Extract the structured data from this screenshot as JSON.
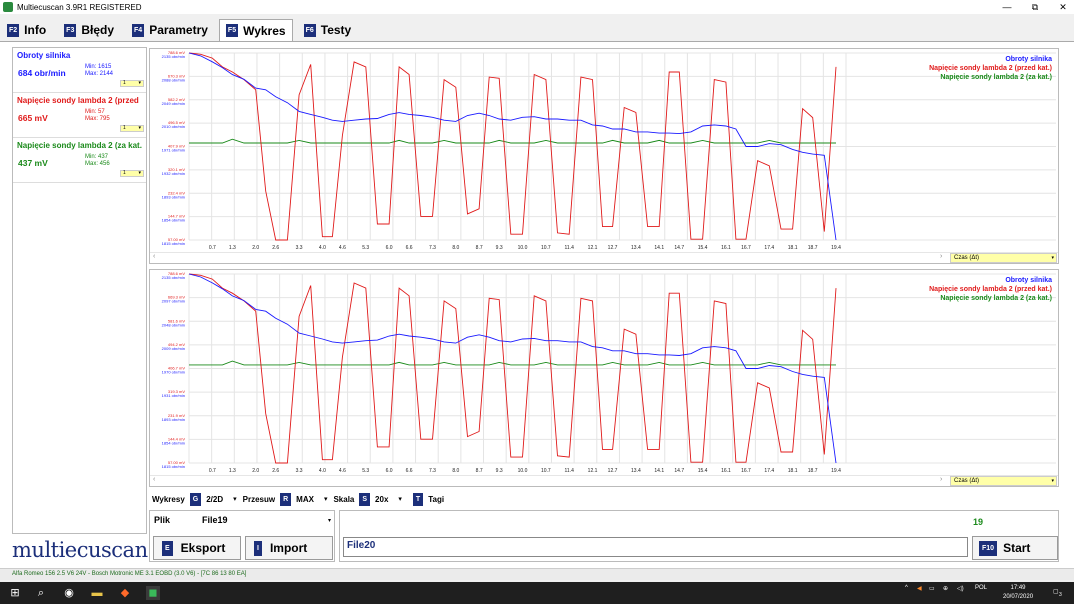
{
  "window": {
    "title": "Multiecuscan 3.9R1 REGISTERED",
    "minimize": "—",
    "maximize": "⧉",
    "close": "✕"
  },
  "tabs": [
    {
      "key": "F2",
      "label": "Info"
    },
    {
      "key": "F3",
      "label": "Błędy"
    },
    {
      "key": "F4",
      "label": "Parametry"
    },
    {
      "key": "F5",
      "label": "Wykres"
    },
    {
      "key": "F6",
      "label": "Testy"
    }
  ],
  "sensors": [
    {
      "name": "Obroty silnika",
      "value": "684 obr/min",
      "min": "Min: 1615",
      "max": "Max: 2144",
      "color": "#1a1aff"
    },
    {
      "name": "Napięcie sondy lambda 2 (przed",
      "value": "665 mV",
      "min": "Min: 57",
      "max": "Max: 795",
      "color": "#e01a1a"
    },
    {
      "name": "Napięcie sondy lambda 2 (za kat.",
      "value": "437 mV",
      "min": "Min: 437",
      "max": "Max: 456",
      "color": "#1a8a1a"
    }
  ],
  "legend": [
    "Obroty silnika",
    "Napięcie sondy lambda 2 (przed kat.)",
    "Napięcie sondy lambda 2 (za kat.)"
  ],
  "chart_data": [
    {
      "type": "line",
      "x_ticks": [
        "0.7",
        "1.3",
        "2.0",
        "2.6",
        "3.3",
        "4.0",
        "4.6",
        "5.3",
        "6.0",
        "6.6",
        "7.3",
        "8.0",
        "8.7",
        "9.3",
        "10.0",
        "10.7",
        "11.4",
        "12.1",
        "12.7",
        "13.4",
        "14.1",
        "14.7",
        "15.4",
        "16.1",
        "16.7",
        "17.4",
        "18.1",
        "18.7",
        "19.4"
      ],
      "y_ticks_mv": [
        "788.6 mV",
        "670.3 mV",
        "582.2 mV",
        "496.5 mV",
        "407.9 mV",
        "320.1 mV",
        "232.4 mV",
        "144.7 mV",
        "57.00 mV"
      ],
      "y_ticks_rpm": [
        "2135 obr/min",
        "2088 obr/min",
        "2049 obr/min",
        "2010 obr/min",
        "1971 obr/min",
        "1932 obr/min",
        "1893 obr/min",
        "1854 obr/min",
        "1815 obr/min"
      ],
      "x": [
        0.0,
        0.35,
        0.7,
        1.0,
        1.3,
        1.65,
        2.0,
        2.3,
        2.6,
        2.95,
        3.3,
        3.65,
        4.0,
        4.3,
        4.6,
        4.95,
        5.3,
        5.65,
        6.0,
        6.3,
        6.6,
        6.95,
        7.3,
        7.65,
        8.0,
        8.35,
        8.7,
        9.0,
        9.3,
        9.65,
        10.0,
        10.35,
        10.7,
        11.05,
        11.4,
        11.75,
        12.1,
        12.4,
        12.7,
        13.05,
        13.4,
        13.75,
        14.1,
        14.4,
        14.7,
        15.05,
        15.4,
        15.75,
        16.1,
        16.4,
        16.7,
        17.05,
        17.4,
        17.75,
        18.1,
        18.4,
        18.7,
        19.05,
        19.4
      ],
      "series": [
        {
          "name": "Obroty silnika",
          "color": "#1a1aff",
          "values": [
            2135,
            2130,
            2120,
            2110,
            2098,
            2090,
            2075,
            2072,
            2060,
            2050,
            2035,
            2030,
            2025,
            2020,
            2018,
            2020,
            2022,
            2023,
            2030,
            2033,
            2030,
            2028,
            2025,
            2020,
            2018,
            2028,
            2032,
            2028,
            2022,
            2020,
            2025,
            2026,
            2022,
            2022,
            2020,
            2020,
            2012,
            2010,
            2005,
            2005,
            2000,
            2000,
            1998,
            1998,
            1997,
            2000,
            2010,
            2012,
            2010,
            2005,
            1975,
            1975,
            1980,
            1978,
            1970,
            1965,
            1962,
            1960,
            1815
          ]
        },
        {
          "name": "Napięcie sondy lambda 2 (przed kat.)",
          "color": "#e01a1a",
          "values": [
            795,
            790,
            775,
            740,
            720,
            690,
            650,
            250,
            57,
            57,
            630,
            750,
            70,
            70,
            470,
            760,
            740,
            120,
            120,
            740,
            710,
            150,
            150,
            690,
            660,
            160,
            180,
            700,
            695,
            80,
            80,
            710,
            690,
            85,
            80,
            700,
            690,
            110,
            110,
            580,
            560,
            110,
            110,
            720,
            720,
            60,
            60,
            690,
            680,
            60,
            60,
            370,
            350,
            100,
            100,
            575,
            540,
            90,
            740
          ]
        },
        {
          "name": "Napięcie sondy lambda 2 (za kat.)",
          "color": "#1a8a1a",
          "values": [
            440,
            440,
            440,
            440,
            455,
            440,
            440,
            440,
            440,
            440,
            450,
            440,
            440,
            440,
            440,
            440,
            440,
            440,
            440,
            450,
            440,
            440,
            440,
            450,
            440,
            440,
            440,
            440,
            450,
            440,
            440,
            440,
            450,
            440,
            440,
            440,
            440,
            440,
            450,
            440,
            440,
            440,
            450,
            440,
            440,
            440,
            450,
            440,
            440,
            440,
            440,
            440,
            450,
            440,
            440,
            440,
            440,
            440,
            440
          ]
        }
      ]
    },
    {
      "type": "line",
      "x_ticks": [
        "0.7",
        "1.3",
        "2.0",
        "2.6",
        "3.3",
        "4.0",
        "4.6",
        "5.3",
        "6.0",
        "6.6",
        "7.3",
        "8.0",
        "8.7",
        "9.3",
        "10.0",
        "10.7",
        "11.4",
        "12.1",
        "12.7",
        "13.4",
        "14.1",
        "14.7",
        "15.4",
        "16.1",
        "16.7",
        "17.4",
        "18.1",
        "18.7",
        "19.4"
      ],
      "y_ticks_mv": [
        "788.6 mV",
        "669.3 mV",
        "581.6 mV",
        "494.2 mV",
        "406.7 mV",
        "319.3 mV",
        "231.9 mV",
        "144.4 mV",
        "57.00 mV"
      ],
      "y_ticks_rpm": [
        "2135 obr/min",
        "2097 obr/min",
        "2048 obr/min",
        "2009 obr/min",
        "1970 obr/min",
        "1931 obr/min",
        "1893 obr/min",
        "1854 obr/min",
        "1815 obr/min"
      ],
      "x": [
        0.0,
        0.35,
        0.7,
        1.0,
        1.3,
        1.65,
        2.0,
        2.3,
        2.6,
        2.95,
        3.3,
        3.65,
        4.0,
        4.3,
        4.6,
        4.95,
        5.3,
        5.65,
        6.0,
        6.3,
        6.6,
        6.95,
        7.3,
        7.65,
        8.0,
        8.35,
        8.7,
        9.0,
        9.3,
        9.65,
        10.0,
        10.35,
        10.7,
        11.05,
        11.4,
        11.75,
        12.1,
        12.4,
        12.7,
        13.05,
        13.4,
        13.75,
        14.1,
        14.4,
        14.7,
        15.05,
        15.4,
        15.75,
        16.1,
        16.4,
        16.7,
        17.05,
        17.4,
        17.75,
        18.1,
        18.4,
        18.7,
        19.05,
        19.4
      ],
      "series": [
        {
          "name": "Obroty silnika",
          "color": "#1a1aff",
          "values": [
            2135,
            2130,
            2120,
            2110,
            2098,
            2090,
            2075,
            2072,
            2060,
            2050,
            2035,
            2030,
            2025,
            2020,
            2018,
            2020,
            2022,
            2023,
            2030,
            2033,
            2030,
            2028,
            2025,
            2020,
            2018,
            2028,
            2032,
            2028,
            2022,
            2020,
            2025,
            2026,
            2022,
            2022,
            2020,
            2020,
            2012,
            2010,
            2005,
            2005,
            2000,
            2000,
            1998,
            1998,
            1997,
            2000,
            2010,
            2012,
            2010,
            2005,
            1975,
            1975,
            1980,
            1978,
            1970,
            1965,
            1962,
            1960,
            1815
          ]
        },
        {
          "name": "Napięcie sondy lambda 2 (przed kat.)",
          "color": "#e01a1a",
          "values": [
            795,
            790,
            775,
            740,
            720,
            690,
            650,
            250,
            57,
            57,
            630,
            750,
            70,
            70,
            470,
            760,
            740,
            120,
            120,
            740,
            710,
            150,
            150,
            690,
            660,
            160,
            180,
            700,
            695,
            80,
            80,
            710,
            690,
            85,
            80,
            700,
            690,
            110,
            110,
            580,
            560,
            110,
            110,
            720,
            720,
            60,
            60,
            690,
            680,
            60,
            60,
            370,
            350,
            100,
            100,
            575,
            540,
            90,
            740
          ]
        },
        {
          "name": "Napięcie sondy lambda 2 (za kat.)",
          "color": "#1a8a1a",
          "values": [
            440,
            440,
            440,
            440,
            455,
            440,
            440,
            440,
            440,
            440,
            450,
            440,
            440,
            440,
            440,
            440,
            440,
            440,
            440,
            450,
            440,
            440,
            440,
            450,
            440,
            440,
            440,
            440,
            450,
            440,
            440,
            440,
            450,
            440,
            440,
            440,
            440,
            440,
            450,
            440,
            440,
            440,
            450,
            440,
            440,
            440,
            450,
            440,
            440,
            440,
            440,
            440,
            450,
            440,
            440,
            440,
            440,
            440,
            440
          ]
        }
      ]
    }
  ],
  "czas_label": "Czas (Δt)",
  "controls": {
    "wykresy_label": "Wykresy",
    "wykresy_key": "G",
    "wykresy_value": "2/2D",
    "przesuw_label": "Przesuw",
    "przesuw_key": "R",
    "przesuw_value": "MAX",
    "skala_label": "Skala",
    "skala_key": "S",
    "skala_value": "20x",
    "tagi_key": "T",
    "tagi_label": "Tagi"
  },
  "file": {
    "label": "Plik",
    "name": "File19",
    "export_key": "E",
    "export_label": "Eksport",
    "import_key": "I",
    "import_label": "Import"
  },
  "record": {
    "counter": "19",
    "filename": "File20",
    "start_key": "F10",
    "start_label": "Start"
  },
  "logo": "multiecuscan",
  "status": {
    "vehicle": "Alfa Romeo 156 2.5 V6 24V - Bosch Motronic ME 3.1 EOBD (3.0 V6) - [7C 86 13 80 EA]"
  },
  "taskbar": {
    "lang": "POL",
    "time": "17:49",
    "date": "20/07/2020",
    "notifications": "3"
  }
}
